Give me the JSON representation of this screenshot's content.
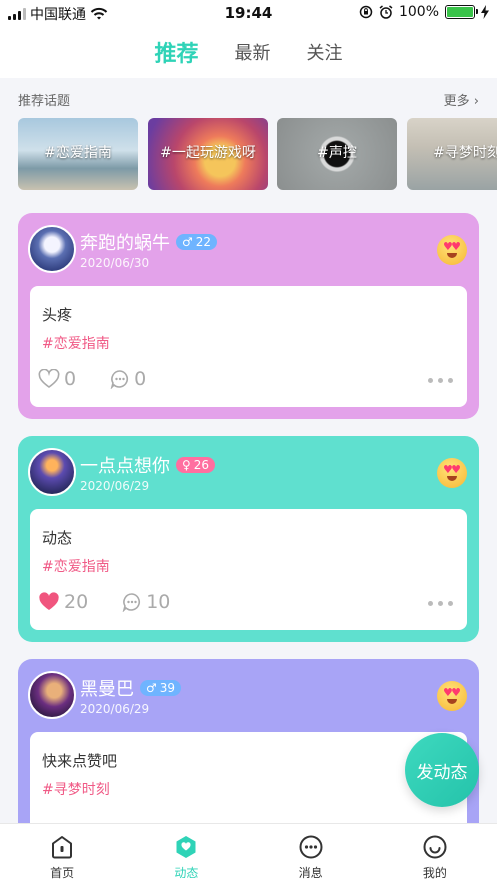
{
  "status_bar": {
    "carrier": "中国联通",
    "time": "19:44",
    "battery": "100%"
  },
  "top_tabs": [
    {
      "label": "推荐",
      "active": true
    },
    {
      "label": "最新",
      "active": false
    },
    {
      "label": "关注",
      "active": false
    }
  ],
  "topics": {
    "title": "推荐话题",
    "more": "更多",
    "items": [
      {
        "label": "#恋爱指南"
      },
      {
        "label": "#一起玩游戏呀"
      },
      {
        "label": "#声控"
      },
      {
        "label": "#寻梦时刻"
      }
    ]
  },
  "posts": [
    {
      "username": "奔跑的蜗牛",
      "gender": "♂",
      "age": "22",
      "date": "2020/06/30",
      "text": "头疼",
      "tag": "#恋爱指南",
      "likes": "0",
      "comments": "0",
      "liked": false,
      "card_color": "#e3a2ea"
    },
    {
      "username": "一点点想你",
      "gender": "♀",
      "age": "26",
      "date": "2020/06/29",
      "text": "动态",
      "tag": "#恋爱指南",
      "likes": "20",
      "comments": "10",
      "liked": true,
      "card_color": "#5fe0cf"
    },
    {
      "username": "黑曼巴",
      "gender": "♂",
      "age": "39",
      "date": "2020/06/29",
      "text": "快来点赞吧",
      "tag": "#寻梦时刻",
      "likes": "",
      "comments": "",
      "liked": false,
      "card_color": "#a8a4f6"
    }
  ],
  "fab_label": "发动态",
  "tabbar": [
    {
      "label": "首页",
      "icon": "home-icon",
      "active": false
    },
    {
      "label": "动态",
      "icon": "feed-icon",
      "active": true
    },
    {
      "label": "消息",
      "icon": "message-icon",
      "active": false
    },
    {
      "label": "我的",
      "icon": "profile-icon",
      "active": false
    }
  ],
  "colors": {
    "accent": "#2fd3b7",
    "tag": "#f05a86",
    "like_active": "#f0557e"
  }
}
